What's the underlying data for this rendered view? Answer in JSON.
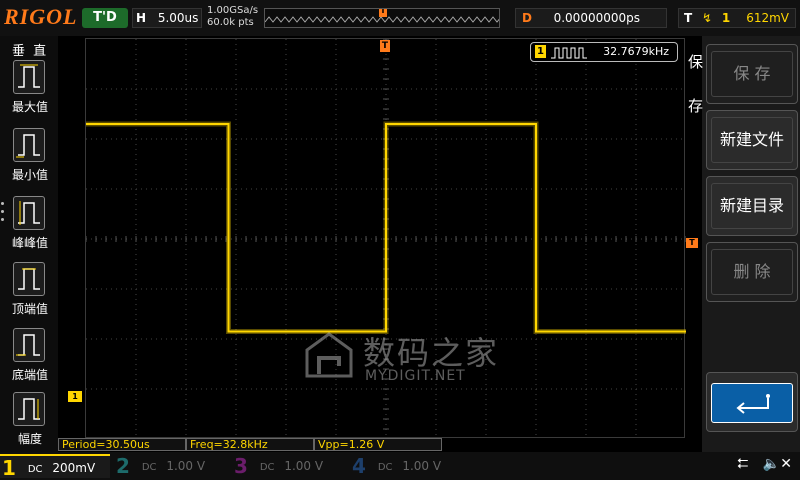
{
  "topbar": {
    "brand": "RIGOL",
    "run_state": "T'D",
    "horizontal": {
      "tag": "H",
      "value": "5.00us"
    },
    "sample_rate": "1.00GSa/s",
    "memory_depth": "60.0k pts",
    "trigger_pos_marker": "T",
    "delay": {
      "tag": "D",
      "value": "0.00000000ps"
    },
    "trigger": {
      "tag": "T",
      "edge_icon": "rising-edge-icon",
      "channel": "1",
      "level": "612mV"
    }
  },
  "sidebar": {
    "title": "垂 直",
    "items": [
      {
        "label": "最大值",
        "icon": "max-value-icon"
      },
      {
        "label": "最小值",
        "icon": "min-value-icon"
      },
      {
        "label": "峰峰值",
        "icon": "peak-to-peak-icon"
      },
      {
        "label": "顶端值",
        "icon": "top-value-icon"
      },
      {
        "label": "底端值",
        "icon": "base-value-icon"
      },
      {
        "label": "幅度",
        "icon": "amplitude-icon"
      }
    ]
  },
  "display": {
    "trigger_marker": "T",
    "trigger_level_marker": "T",
    "channel_ground_marker": "1",
    "frequency_counter": {
      "channel": "1",
      "value": "32.7679kHz"
    },
    "watermark": {
      "cn": "数码之家",
      "en": "MYDIGIT.NET"
    }
  },
  "chart_data": {
    "type": "line",
    "title": "",
    "xlabel": "",
    "ylabel": "",
    "series": [
      {
        "x": [
          0,
          0.95,
          0.95,
          2,
          2,
          3.0,
          3.0,
          4
        ],
        "values": [
          1,
          1,
          0,
          0,
          1,
          1,
          0,
          0
        ]
      }
    ],
    "x_unit": "divisions",
    "y_levels": {
      "high_div": 2.3,
      "low_div": -1.85
    },
    "grid": true,
    "color": "#ffd600"
  },
  "menu": {
    "title": "保存",
    "softkeys": [
      {
        "label": "保 存",
        "enabled": false
      },
      {
        "label": "新建文件",
        "enabled": true
      },
      {
        "label": "新建目录",
        "enabled": true
      },
      {
        "label": "删 除",
        "enabled": false
      }
    ],
    "enter_icon": "enter-icon"
  },
  "measurements": {
    "period": "Period=30.50us",
    "freq": "Freq=32.8kHz",
    "vpp": "Vpp=1.26 V"
  },
  "channels": [
    {
      "num": "1",
      "coupling": "DC",
      "scale": "200mV",
      "active": true
    },
    {
      "num": "2",
      "coupling": "DC",
      "scale": "1.00 V",
      "active": false
    },
    {
      "num": "3",
      "coupling": "DC",
      "scale": "1.00 V",
      "active": false
    },
    {
      "num": "4",
      "coupling": "DC",
      "scale": "1.00 V",
      "active": false
    }
  ],
  "colors": {
    "trace": "#ffd600",
    "trigger": "#ff7a1a",
    "brand": "#ff7a1a"
  }
}
